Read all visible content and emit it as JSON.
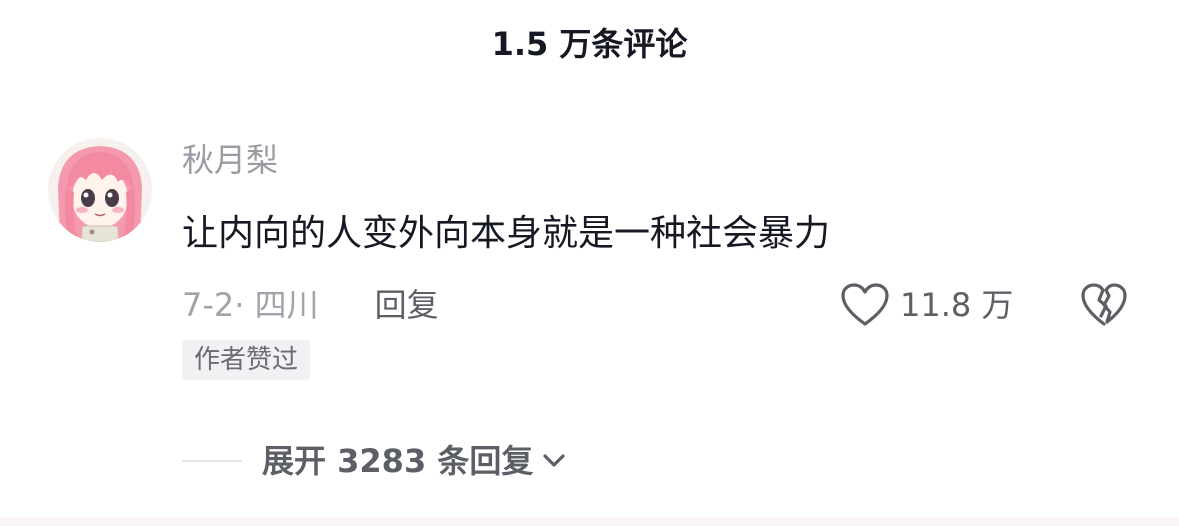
{
  "header": {
    "title": "1.5 万条评论"
  },
  "comment": {
    "username": "秋月梨",
    "text": "让内向的人变外向本身就是一种社会暴力",
    "date_location": "7-2· 四川",
    "reply_label": "回复",
    "like_count": "11.8 万",
    "author_badge": "作者赞过",
    "expand_label": "展开 3283 条回复"
  },
  "icons": {
    "like": "heart-outline-icon",
    "dislike": "broken-heart-icon",
    "expand": "chevron-down-icon"
  },
  "colors": {
    "text_primary": "#161823",
    "text_secondary": "#9a9ca3",
    "action_text": "#5d5f66",
    "badge_background": "#f1f1f3",
    "avatar_hair": "#f59aae"
  }
}
